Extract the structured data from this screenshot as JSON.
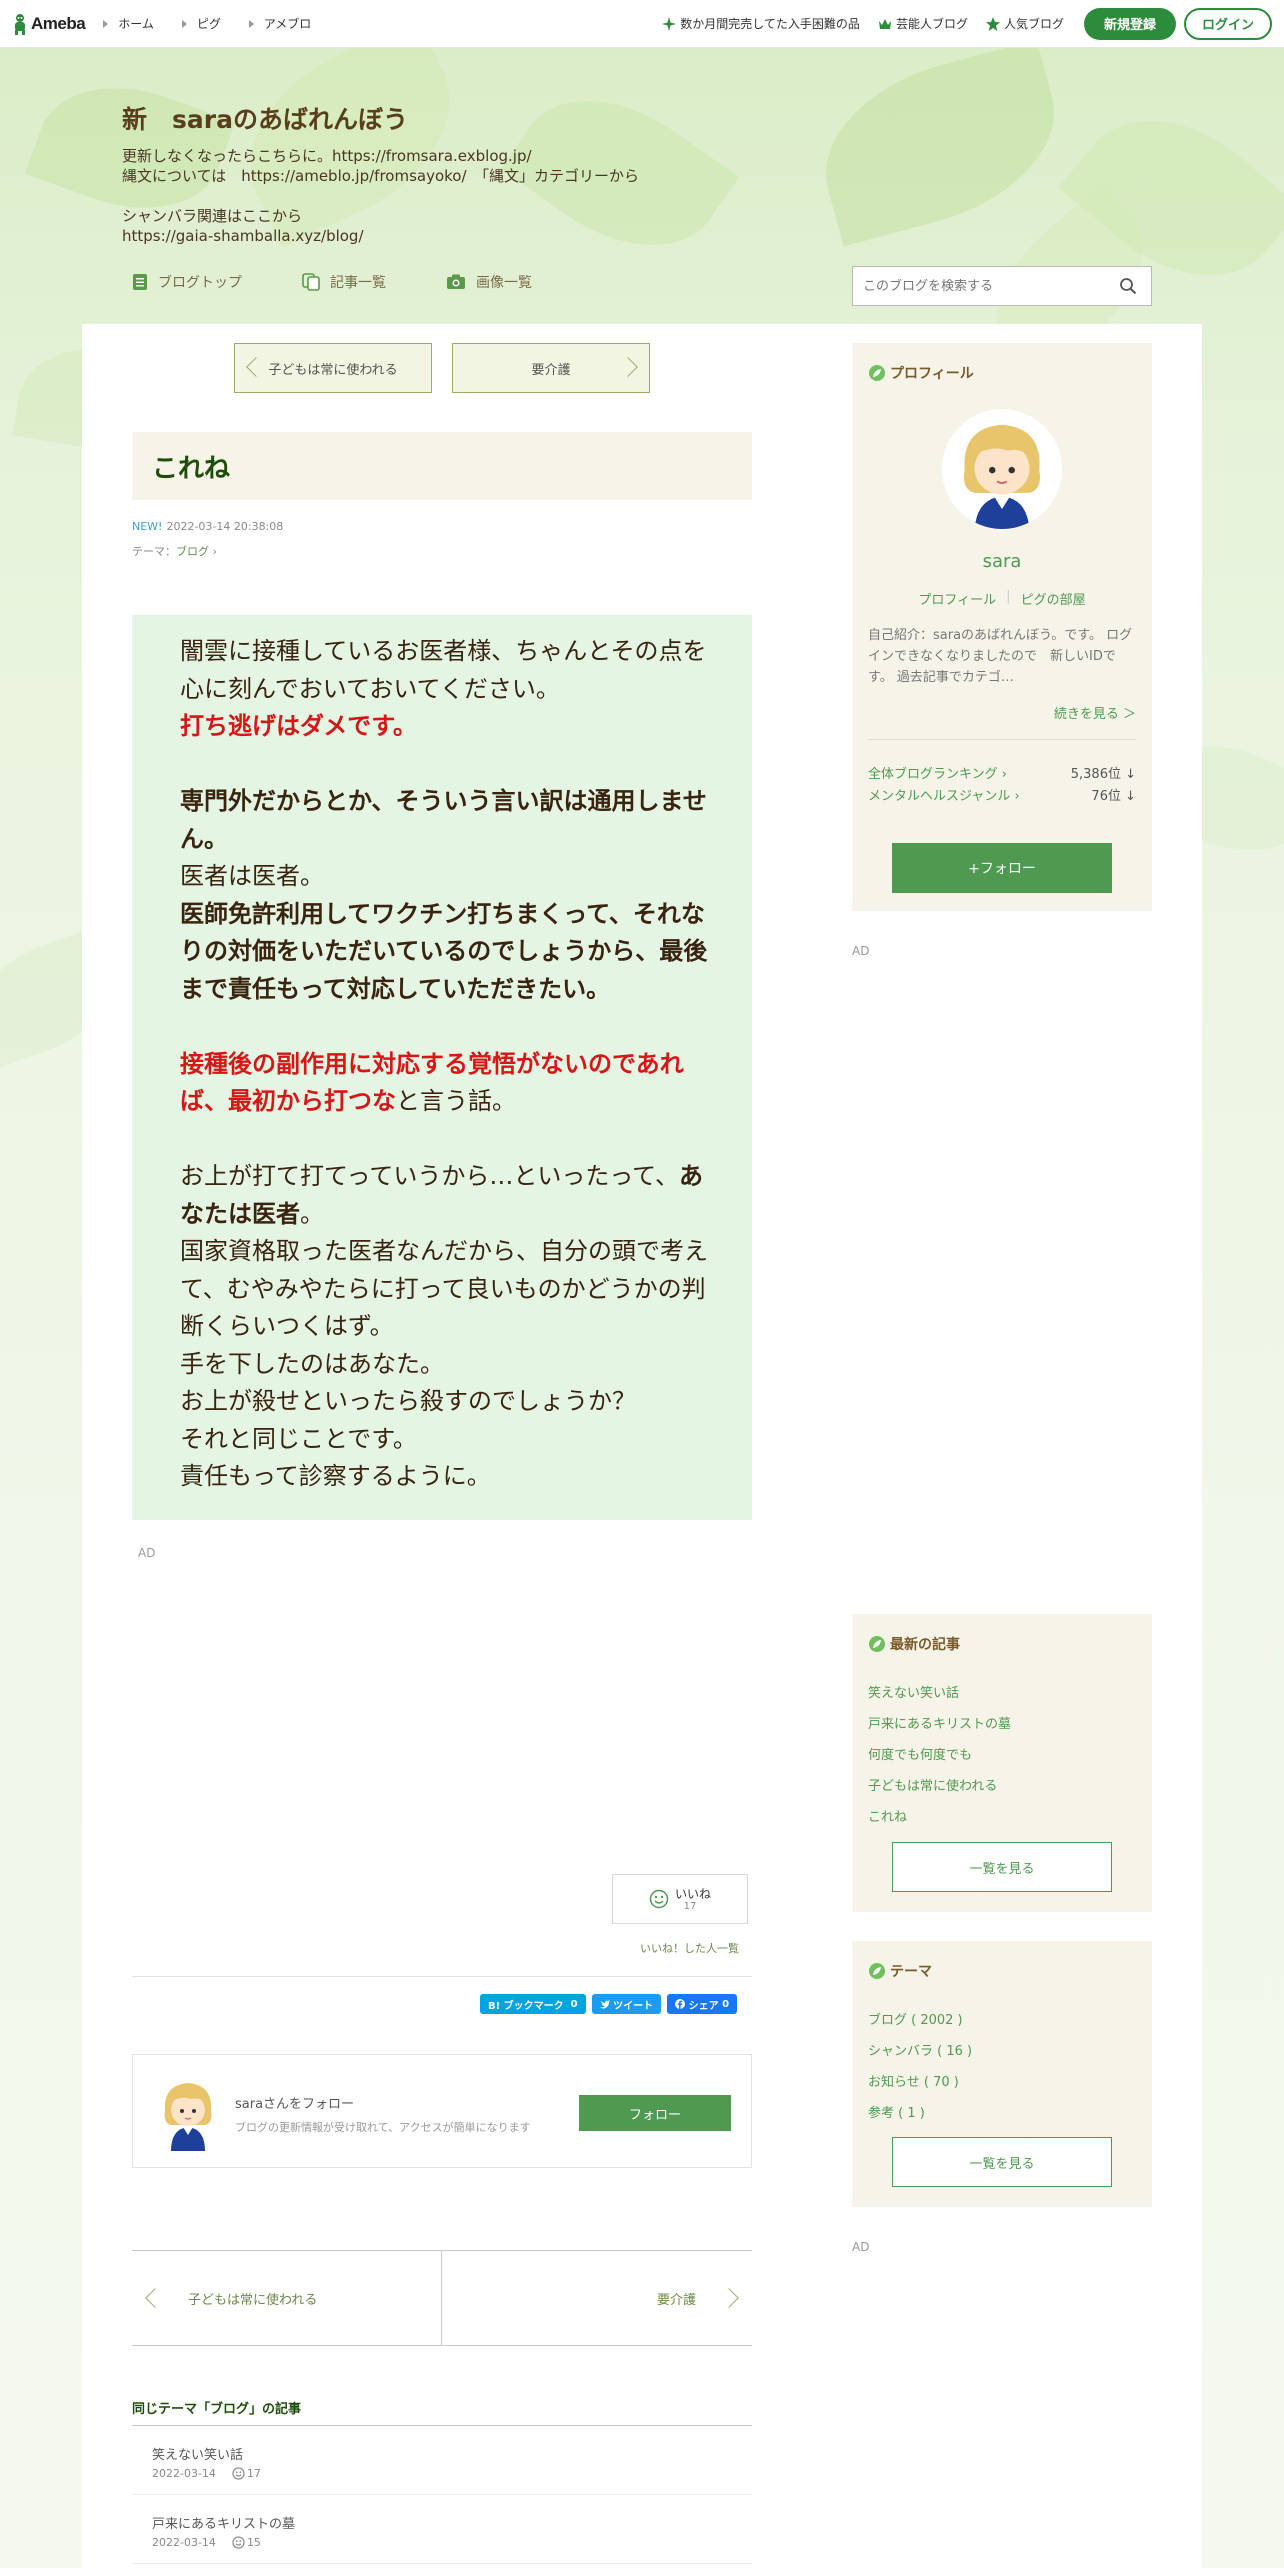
{
  "global_header": {
    "logo": "Ameba",
    "nav": [
      "ホーム",
      "ピグ",
      "アメブロ"
    ],
    "links": [
      "数か月間完売してた入手困難の品",
      "芸能人ブログ",
      "人気ブログ"
    ],
    "signup": "新規登録",
    "login": "ログイン"
  },
  "blog": {
    "title": "新　saraのあばれんぼう",
    "description": "更新しなくなったらこちらに。https://fromsara.exblog.jp/\n縄文については　https://ameblo.jp/fromsayoko/　「縄文」カテゴリーから\n\nシャンバラ関連はここから\nhttps://gaia-shamballa.xyz/blog/",
    "nav": [
      "ブログトップ",
      "記事一覧",
      "画像一覧"
    ],
    "search_placeholder": "このブログを検索する"
  },
  "pager_top": {
    "prev": "子どもは常に使われる",
    "next": "要介護"
  },
  "article": {
    "title": "これね",
    "new_badge": "NEW!",
    "datetime": "2022-03-14 20:38:08",
    "theme_label": "テーマ：",
    "theme": "ブログ",
    "body": {
      "l1": "闇雲に接種しているお医者様、ちゃんとその点を心に刻んでおいておいてください。",
      "l2": "打ち逃げはダメです。",
      "l3": "専門外だからとか、そういう言い訳は通用しません。",
      "l4": "医者は医者。",
      "l5": "医師免許利用してワクチン打ちまくって、それなりの対価をいただいているのでしょうから、最後まで責任もって対応していただきたい。",
      "l6a": "接種後の副作用に対応する覚悟がないのであれば、最初から打つな",
      "l6b": "と言う話。",
      "l7a": "お上が打て打てっていうから…といったって、",
      "l7b": "あなたは医者",
      "l7c": "。",
      "l8": "国家資格取った医者なんだから、自分の頭で考えて、むやみやたらに打って良いものかどうかの判断くらいつくはず。",
      "l9": "手を下したのはあなた。",
      "l10": "お上が殺せといったら殺すのでしょうか？",
      "l11": "それと同じことです。",
      "l12": "責任もって診察するように。"
    },
    "ad": "AD",
    "like_label": "いいね",
    "like_count": "17",
    "like_list": "いいね！した人一覧",
    "share": {
      "hatena": "B! ブックマーク",
      "hatena_count": "0",
      "tweet": "ツイート",
      "fb": "シェア",
      "fb_count": "0"
    }
  },
  "follow_card": {
    "name": "saraさんをフォロー",
    "sub": "ブログの更新情報が受け取れて、アクセスが簡単になります",
    "button": "フォロー"
  },
  "pager_bottom": {
    "prev": "子どもは常に使われる",
    "next": "要介護"
  },
  "same_theme": {
    "title": "同じテーマ「ブログ」の記事",
    "items": [
      {
        "title": "笑えない笑い話",
        "date": "2022-03-14",
        "likes": "17"
      },
      {
        "title": "戸来にあるキリストの墓",
        "date": "2022-03-14",
        "likes": "15"
      }
    ]
  },
  "sidebar": {
    "profile_title": "プロフィール",
    "name": "sara",
    "link_profile": "プロフィール",
    "link_pig": "ピグの部屋",
    "intro": "自己紹介：saraのあばれんぼう。です。 ログインできなくなりましたので　新しいIDです。 過去記事でカテゴ…",
    "more": "続きを見る ＞",
    "rank1_label": "全体ブログランキング",
    "rank1_value": "5,386位 ↓",
    "rank2_label": "メンタルヘルスジャンル",
    "rank2_value": "76位 ↓",
    "follow": "+フォロー",
    "ad1": "AD",
    "latest_title": "最新の記事",
    "latest": [
      "笑えない笑い話",
      "戸来にあるキリストの墓",
      "何度でも何度でも",
      "子どもは常に使われる",
      "これね"
    ],
    "latest_more": "一覧を見る",
    "theme_title": "テーマ",
    "themes": [
      "ブログ ( 2002 )",
      "シャンバラ ( 16 )",
      "お知らせ ( 70 )",
      "参考 ( 1 )"
    ],
    "theme_more": "一覧を見る",
    "ad2": "AD"
  },
  "colors": {
    "accent": "#4f9a50",
    "signup": "#2d8c3c",
    "red_text": "#d51717",
    "title_green": "#1e4c0a"
  }
}
